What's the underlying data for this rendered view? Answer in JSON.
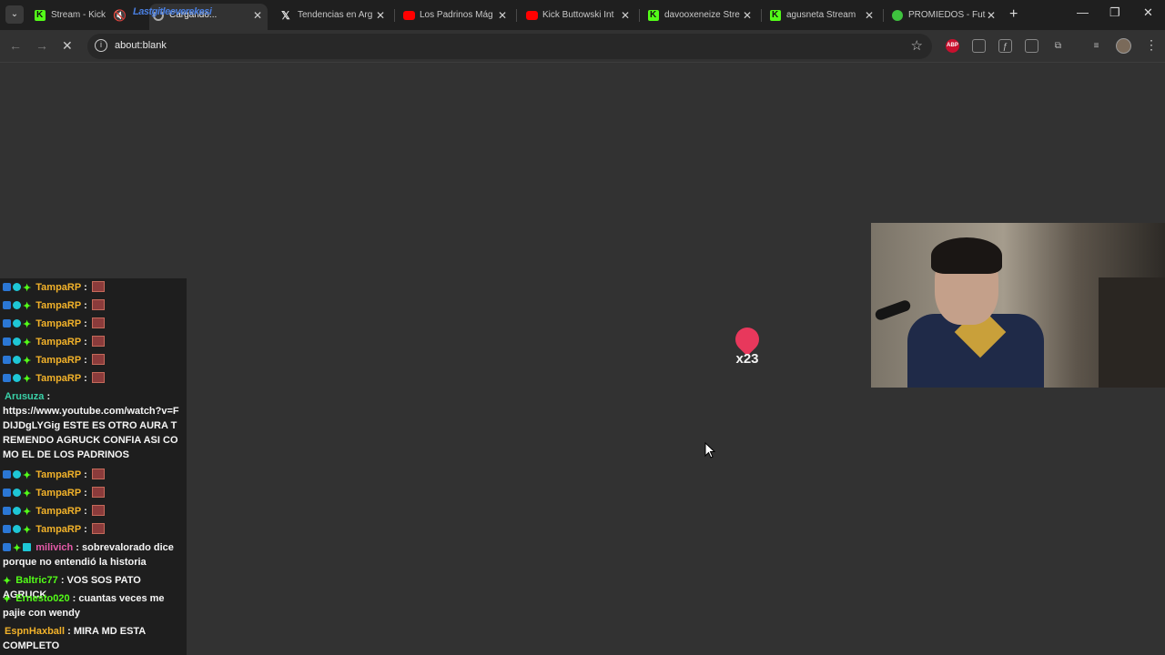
{
  "browser": {
    "tabs": [
      {
        "title": "Stream - Kick",
        "favicon": "kick-icon"
      },
      {
        "title": "Cargando...",
        "favicon": "loading-icon"
      },
      {
        "title": "Tendencias en Arg",
        "favicon": "x-icon"
      },
      {
        "title": "Los Padrinos Mág",
        "favicon": "youtube-icon"
      },
      {
        "title": "Kick Buttowski Int",
        "favicon": "youtube-icon"
      },
      {
        "title": "davooxeneize Stre",
        "favicon": "kick-icon"
      },
      {
        "title": "agusneta Stream",
        "favicon": "kick-icon"
      },
      {
        "title": "PROMIEDOS - Fut",
        "favicon": "promiedos-icon"
      }
    ],
    "overlay_text": "Lastgitleeverekesi",
    "address": "about:blank",
    "extension_abp": "ABP"
  },
  "chat": {
    "messages": [
      {
        "user": "TampaRP",
        "text": "",
        "color": "#f2b22a"
      },
      {
        "user": "TampaRP",
        "text": "",
        "color": "#f2b22a"
      },
      {
        "user": "TampaRP",
        "text": "",
        "color": "#f2b22a"
      },
      {
        "user": "TampaRP",
        "text": "",
        "color": "#f2b22a"
      },
      {
        "user": "TampaRP",
        "text": "",
        "color": "#f2b22a"
      },
      {
        "user": "TampaRP",
        "text": "",
        "color": "#f2b22a"
      },
      {
        "user": "Arusuza",
        "text": "https://www.youtube.com/watch?v=FDIJDgLYGig ESTE ES OTRO AURA TREMENDO AGRUCK CONFIA ASI COMO EL DE LOS PADRINOS",
        "color": "#3ad1a8"
      },
      {
        "user": "TampaRP",
        "text": "",
        "color": "#f2b22a"
      },
      {
        "user": "TampaRP",
        "text": "",
        "color": "#f2b22a"
      },
      {
        "user": "TampaRP",
        "text": "",
        "color": "#f2b22a"
      },
      {
        "user": "TampaRP",
        "text": "",
        "color": "#f2b22a"
      },
      {
        "user": "milivich",
        "text": "sobrevalorado dice porque no entendió la historia",
        "color": "#e45aa8"
      },
      {
        "user": "Baltric77",
        "text": "VOS SOS PATO AGRUCK",
        "color": "#53fc18"
      },
      {
        "user": "Ernesto020",
        "text": "cuantas veces me pajie con wendy",
        "color": "#53fc18"
      },
      {
        "user": "EspnHaxball",
        "text": "MIRA MD ESTA COMPLETO",
        "color": "#f2b22a"
      }
    ]
  },
  "stream": {
    "sticker_multiplier": "x23"
  }
}
